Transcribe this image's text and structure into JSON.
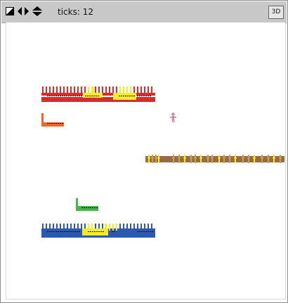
{
  "toolbar": {
    "ticks_label": "ticks: 12",
    "button_3d": "3D",
    "icons": [
      "zoom-icon",
      "horizontal-arrows-icon",
      "vertical-arrows-icon"
    ]
  },
  "colors": {
    "toolbar_bg": "#c8c8c8",
    "view_bg": "#ffffff",
    "red_team": "#dc2a28",
    "blue_team": "#2d58b0",
    "orange": "#f0662a",
    "green": "#4ab24a",
    "yellow": "#f4ec28",
    "brown": "#9a6a45",
    "pink": "#e4789c"
  },
  "entities": [
    {
      "name": "red-factory-row"
    },
    {
      "name": "orange-factory"
    },
    {
      "name": "pink-person"
    },
    {
      "name": "brown-road"
    },
    {
      "name": "green-factory"
    },
    {
      "name": "blue-factory-row"
    }
  ]
}
